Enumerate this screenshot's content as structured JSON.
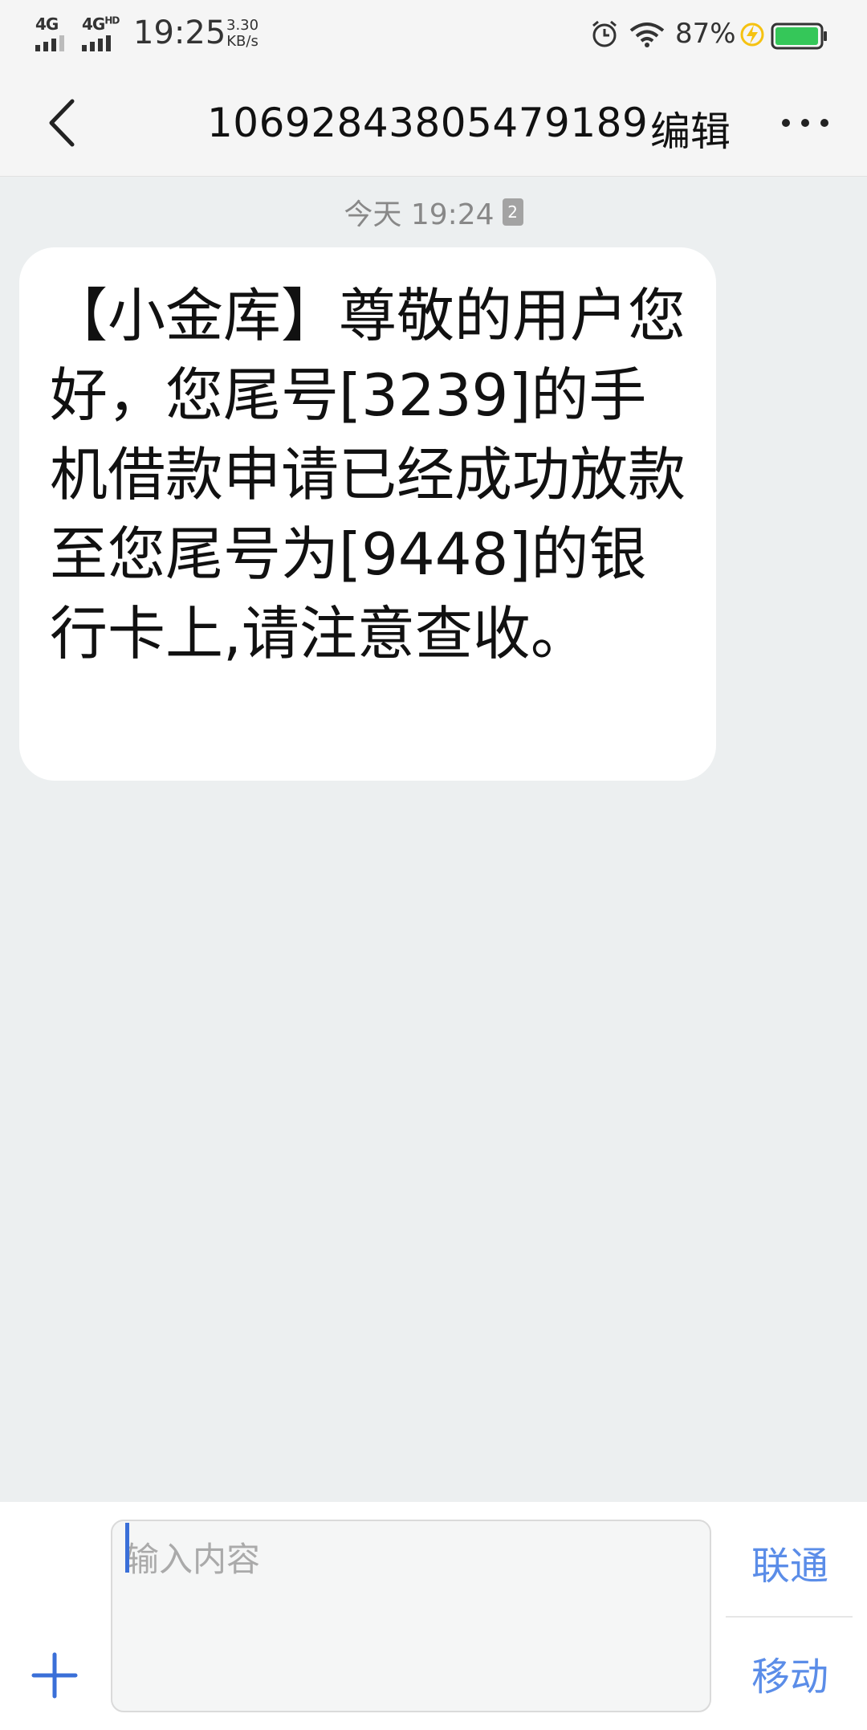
{
  "status_bar": {
    "network1": "4G",
    "network2": "4G",
    "network2_suffix": "HD",
    "time": "19:25",
    "speed_value": "3.30",
    "speed_unit": "KB/s",
    "battery_percent": "87%"
  },
  "nav": {
    "title": "10692843805479189",
    "edit_label": "编辑"
  },
  "conversation": {
    "timestamp": "今天 19:24",
    "sim_badge": "2",
    "messages": [
      {
        "text": "【小金库】尊敬的用户您好，您尾号[3239]的手机借款申请已经成功放款至您尾号为[9448]的银行卡上,请注意查收。"
      }
    ]
  },
  "composer": {
    "placeholder": "输入内容",
    "send_unicom_label": "联通",
    "send_mobile_label": "移动"
  },
  "colors": {
    "accent": "#5b8de8",
    "battery": "#35c759",
    "bolt": "#f5c211",
    "background": "#eceff0"
  }
}
